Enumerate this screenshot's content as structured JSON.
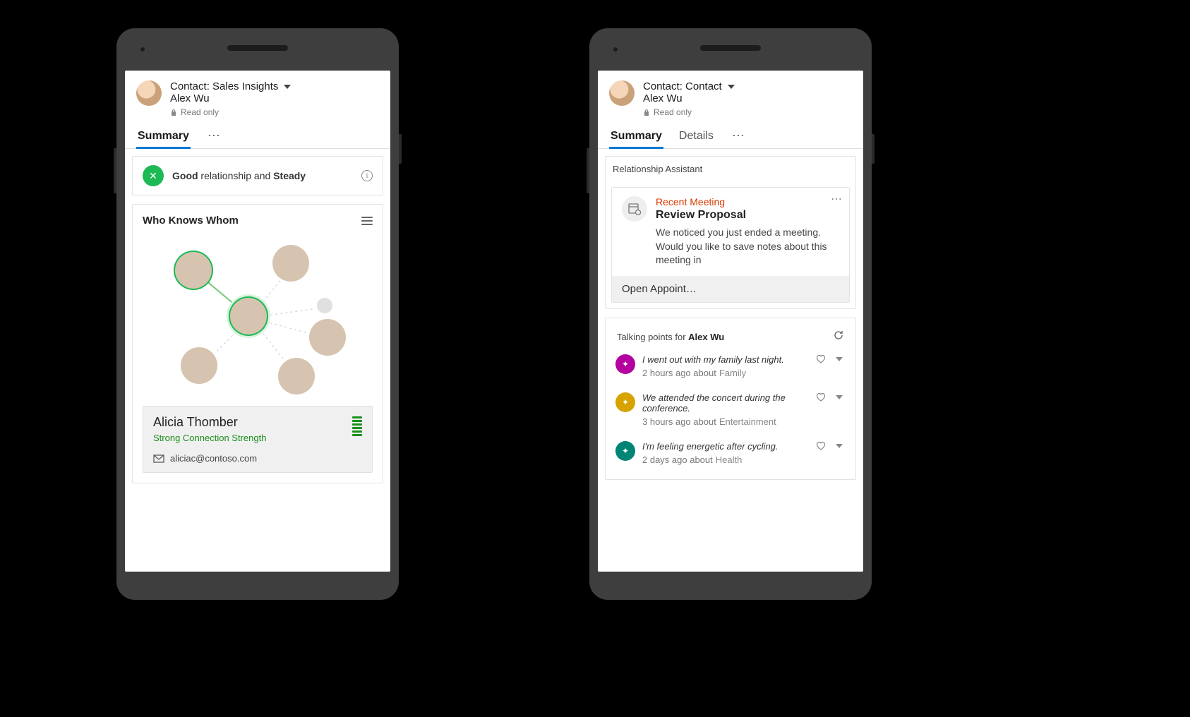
{
  "left": {
    "header": {
      "entityLine": "Contact: Sales Insights",
      "name": "Alex Wu",
      "readonly": "Read only"
    },
    "tabs": {
      "summary": "Summary"
    },
    "relationship": {
      "good": "Good",
      "mid": " relationship and ",
      "steady": "Steady"
    },
    "wkw": {
      "title": "Who Knows Whom"
    },
    "selected": {
      "name": "Alicia Thomber",
      "strength": "Strong Connection Strength",
      "email": "aliciac@contoso.com"
    }
  },
  "right": {
    "header": {
      "entityLine": "Contact: Contact",
      "name": "Alex Wu",
      "readonly": "Read only"
    },
    "tabs": {
      "summary": "Summary",
      "details": "Details"
    },
    "ra": {
      "sectionTitle": "Relationship Assistant",
      "tag": "Recent Meeting",
      "title": "Review Proposal",
      "message": "We noticed you just ended a meeting. Would you like to save notes about this meeting in",
      "action": "Open Appoint…"
    },
    "tp": {
      "headPrefix": "Talking points for ",
      "headName": "Alex Wu",
      "items": [
        {
          "msg": "I went out with my family last night.",
          "time": "2 hours ago about ",
          "topic": "Family",
          "color": "#b4009e"
        },
        {
          "msg": "We attended the concert during the conference.",
          "time": "3 hours ago about ",
          "topic": "Entertainment",
          "color": "#d6a300"
        },
        {
          "msg": "I'm feeling energetic after cycling.",
          "time": "2 days ago about ",
          "topic": "Health",
          "color": "#008575"
        }
      ]
    }
  }
}
